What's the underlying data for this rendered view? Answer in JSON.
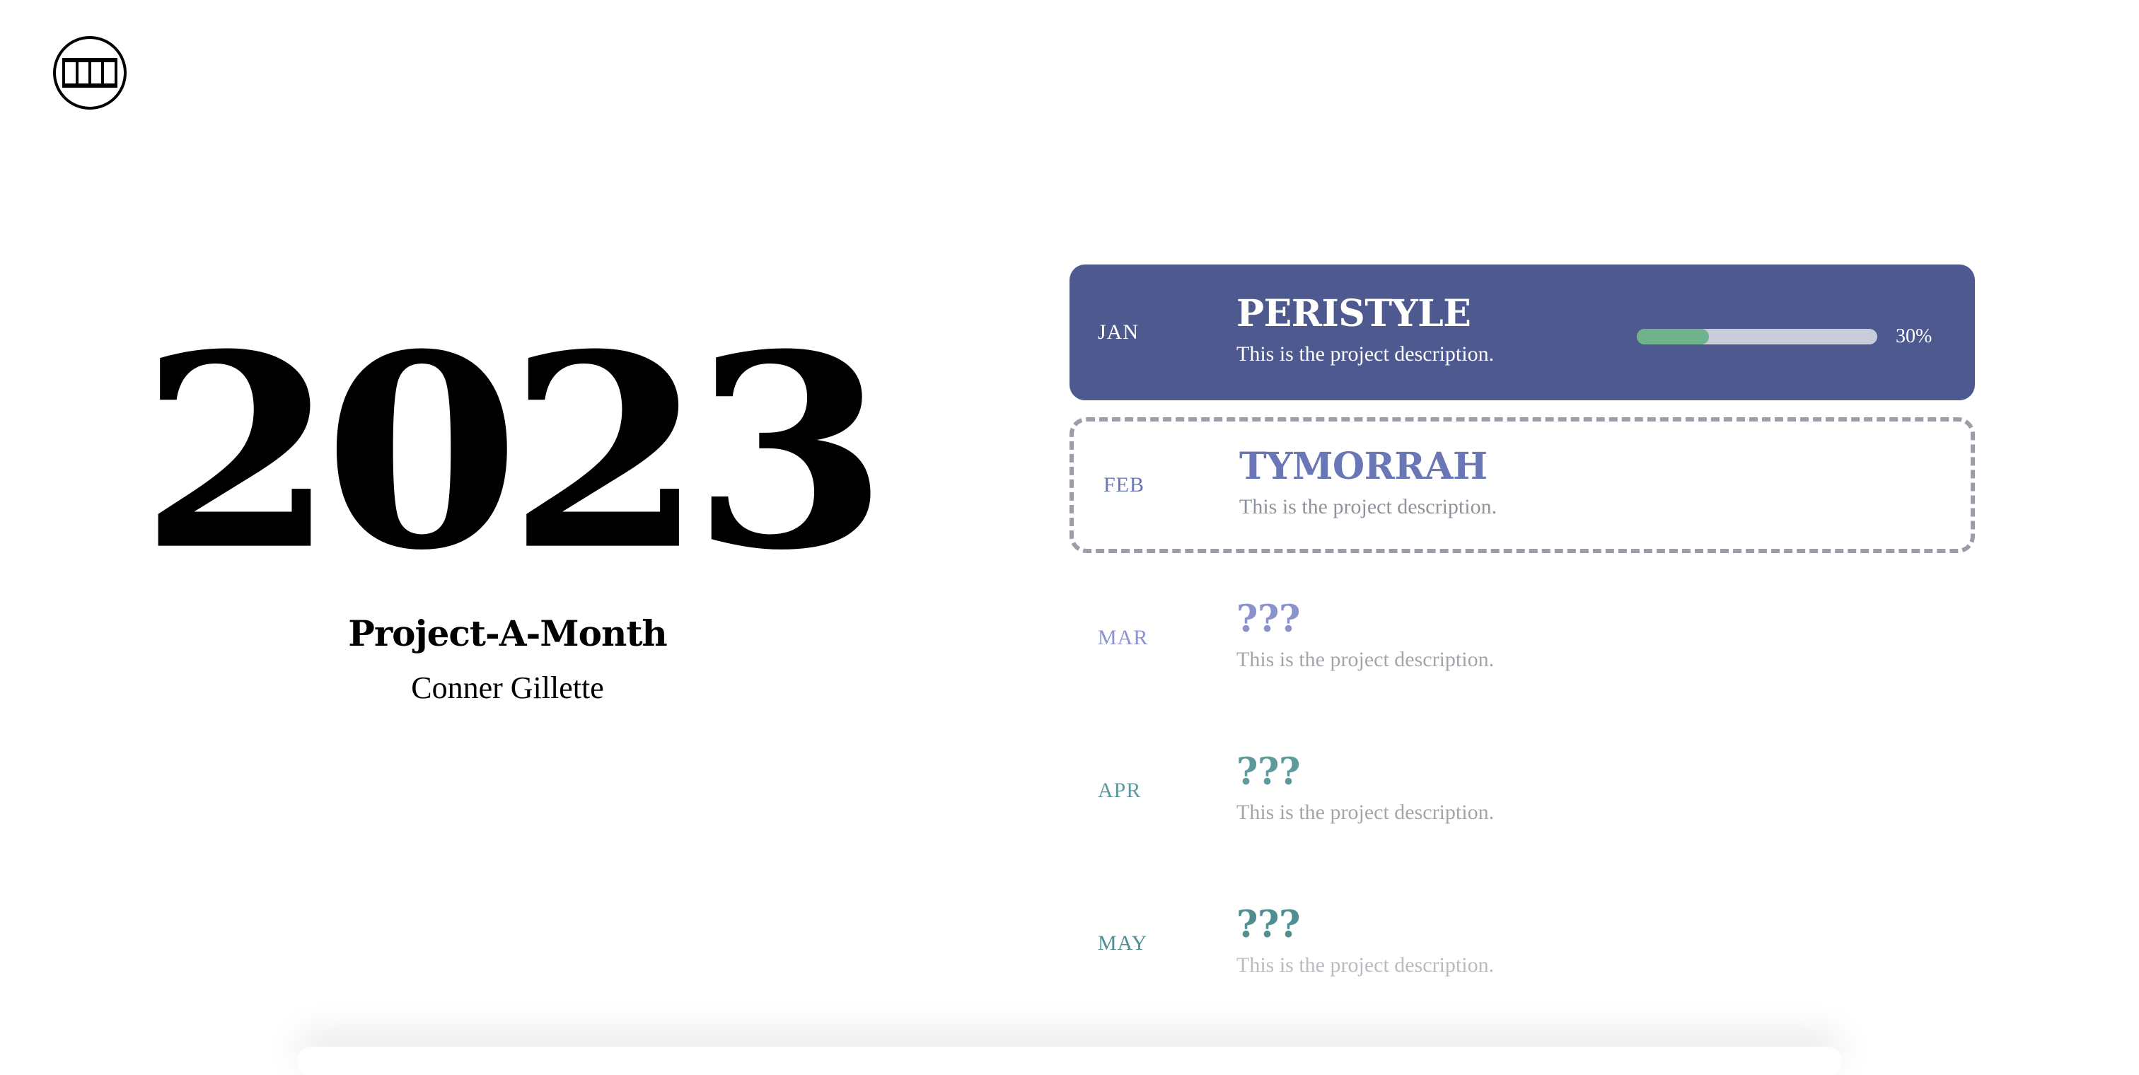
{
  "logo": {
    "icon": "peristyle-columns-icon",
    "color": "#000000"
  },
  "hero": {
    "year": "2023",
    "title": "Project-A-Month",
    "author": "Conner Gillette"
  },
  "projects": [
    {
      "month": "JAN",
      "name": "PERISTYLE",
      "description": "This is the project description.",
      "progress": 0.3,
      "progress_label": "30%",
      "state": "active",
      "colors": {
        "bg": "#4e5a8f",
        "text": "#ffffff",
        "progress_fill": "#6fb38c",
        "progress_track": "#c9cddb"
      }
    },
    {
      "month": "FEB",
      "name": "TYMORRAH",
      "description": "This is the project description.",
      "state": "next",
      "colors": {
        "month": "#6a77b6",
        "name": "#6a77b6",
        "desc": "#8e939c",
        "border": "#9a9ea8"
      }
    },
    {
      "month": "MAR",
      "name": "???",
      "description": "This is the project description.",
      "state": "upcoming",
      "colors": {
        "month": "#8b93cc",
        "name": "#8b93cc",
        "desc": "#a3a5ab"
      }
    },
    {
      "month": "APR",
      "name": "???",
      "description": "This is the project description.",
      "state": "upcoming",
      "colors": {
        "month": "#5e9a9c",
        "name": "#5e9a9c",
        "desc": "#a3a5ab"
      }
    },
    {
      "month": "MAY",
      "name": "???",
      "description": "This is the project description.",
      "state": "upcoming",
      "colors": {
        "month": "#4f8f92",
        "name": "#4f8f92",
        "desc": "#b9bbc0"
      }
    }
  ]
}
